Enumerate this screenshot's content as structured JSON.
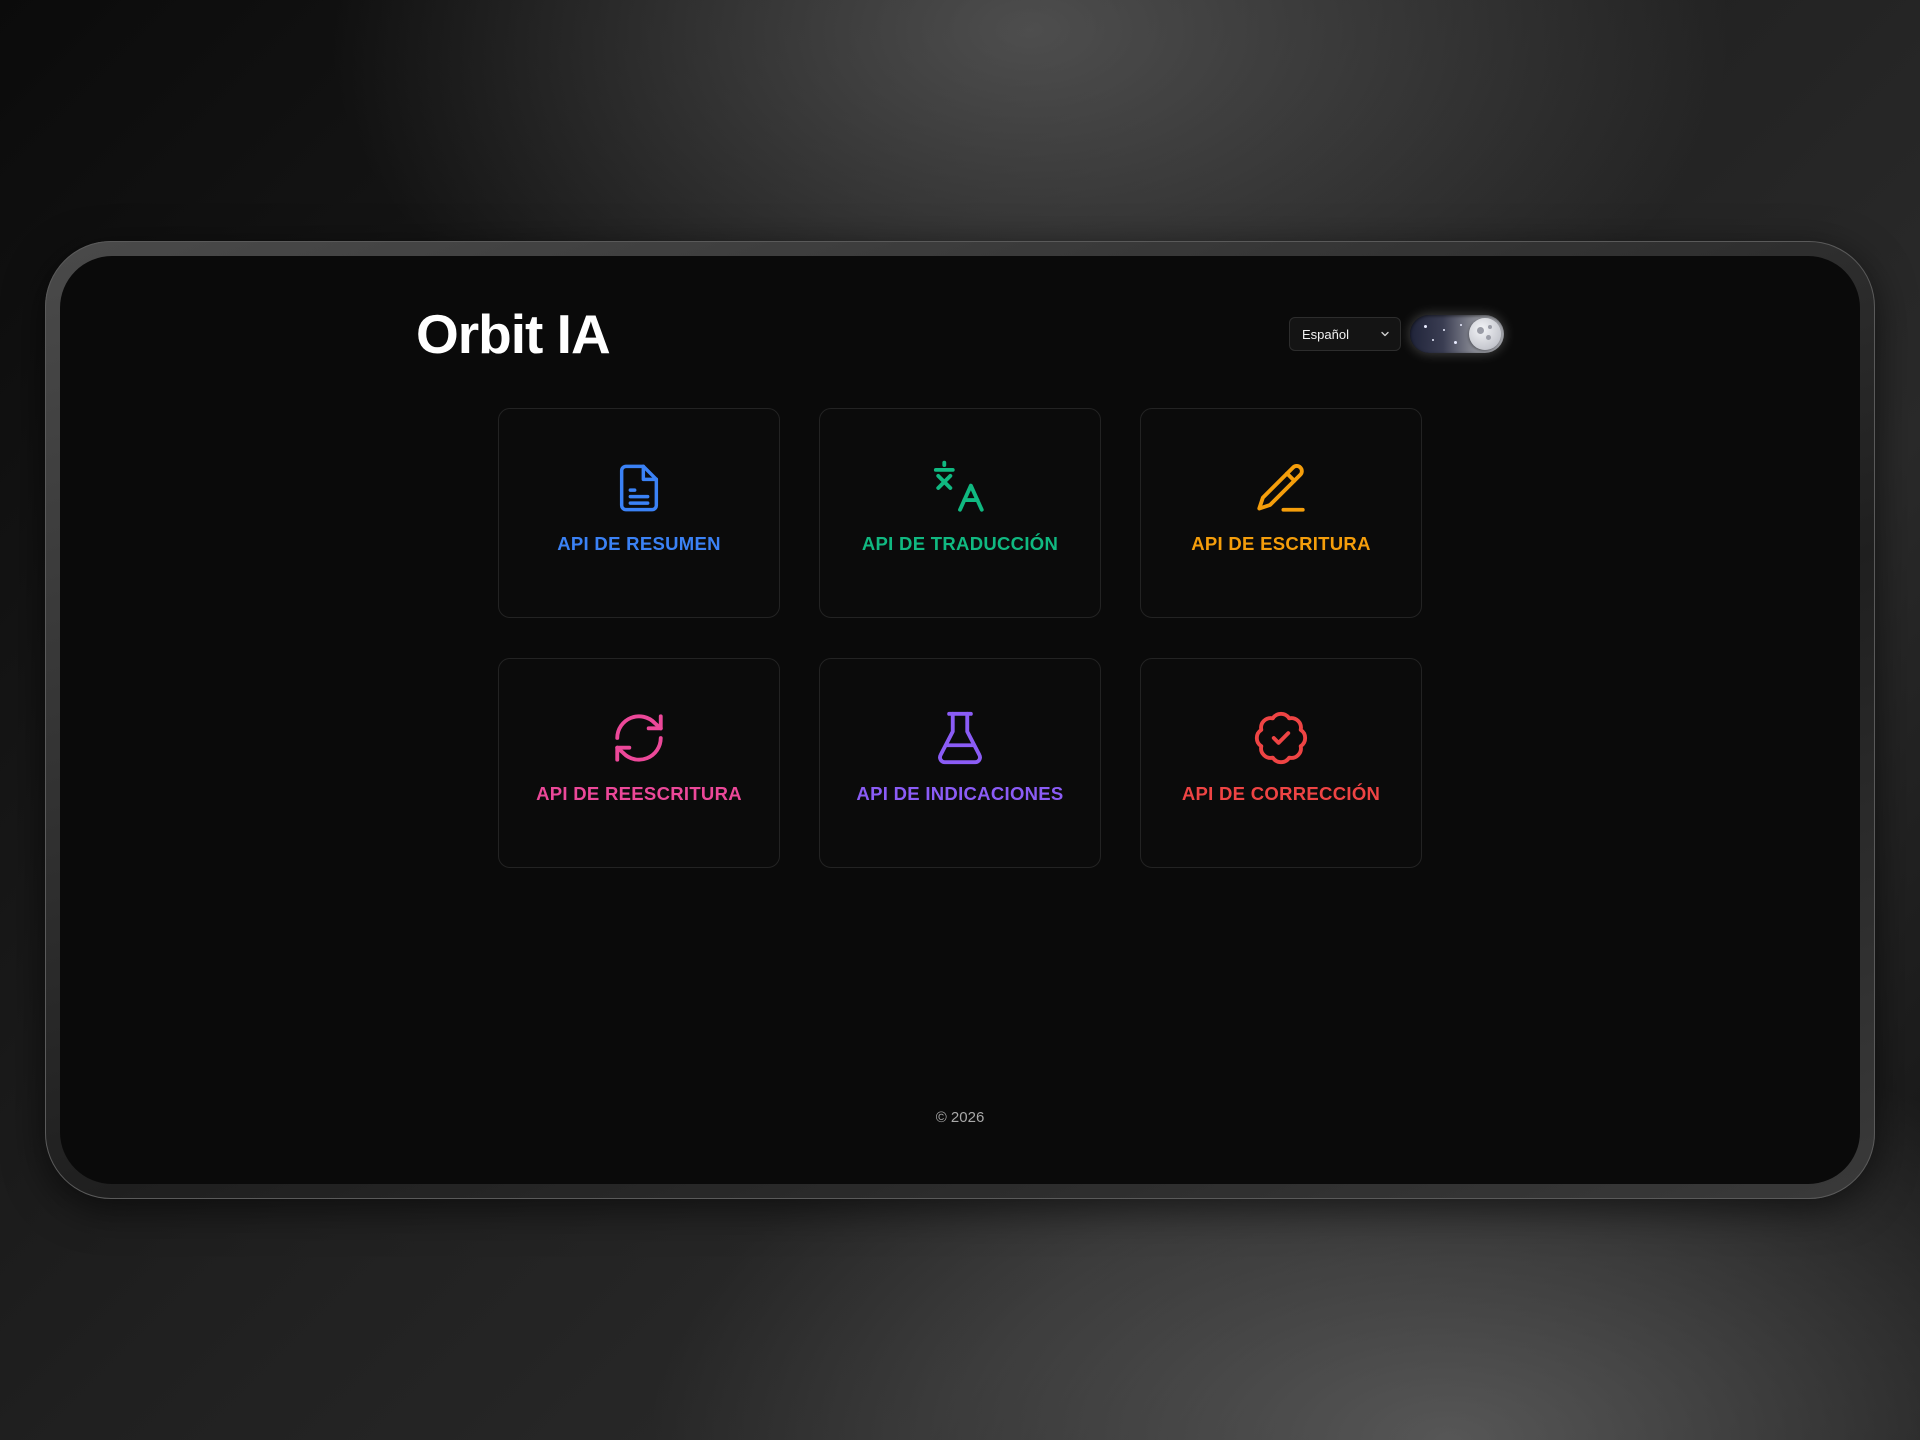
{
  "header": {
    "title": "Orbit IA",
    "language_selected": "Español",
    "theme_toggle": "dark-mode-toggle"
  },
  "cards": [
    {
      "label": "API DE RESUMEN",
      "icon": "document-icon",
      "color": "#3b82f6"
    },
    {
      "label": "API DE TRADUCCIÓN",
      "icon": "translate-icon",
      "color": "#10b981"
    },
    {
      "label": "API DE ESCRITURA",
      "icon": "pencil-icon",
      "color": "#f59e0b"
    },
    {
      "label": "API DE REESCRITURA",
      "icon": "refresh-icon",
      "color": "#ec4899"
    },
    {
      "label": "API DE INDICACIONES",
      "icon": "flask-icon",
      "color": "#8b5cf6"
    },
    {
      "label": "API DE CORRECCIÓN",
      "icon": "badge-check-icon",
      "color": "#ef4444"
    }
  ],
  "footer": {
    "copyright": "© 2026"
  }
}
